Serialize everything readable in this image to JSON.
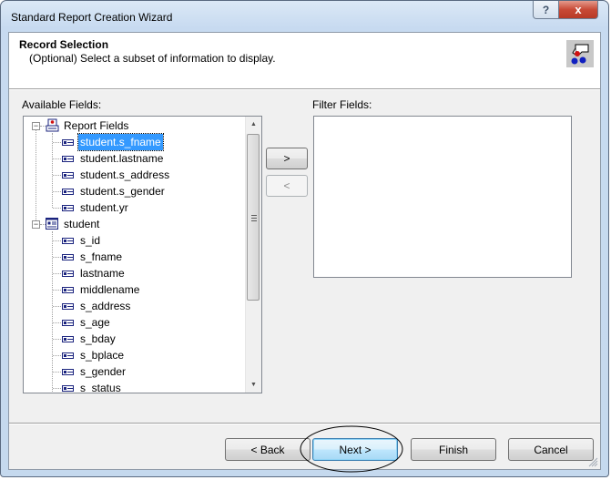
{
  "window": {
    "title": "Standard Report Creation Wizard",
    "help_label": "?",
    "close_label": "x"
  },
  "header": {
    "title": "Record Selection",
    "subtitle": "(Optional)  Select a subset of information to display.",
    "icon": "record-selection-wizard-icon"
  },
  "available": {
    "label": "Available Fields:",
    "groups": [
      {
        "label": "Report Fields",
        "icon": "report-fields-icon",
        "expanded": true,
        "items": [
          "student.s_fname",
          "student.lastname",
          "student.s_address",
          "student.s_gender",
          "student.yr"
        ]
      },
      {
        "label": "student",
        "icon": "table-icon",
        "expanded": true,
        "items": [
          "s_id",
          "s_fname",
          "lastname",
          "middlename",
          "s_address",
          "s_age",
          "s_bday",
          "s_bplace",
          "s_gender",
          "s_status"
        ]
      }
    ],
    "selected": "student.s_fname"
  },
  "move": {
    "add_label": ">",
    "remove_label": "<"
  },
  "filter": {
    "label": "Filter Fields:",
    "items": []
  },
  "footer": {
    "back_label": "< Back",
    "next_label": "Next >",
    "finish_label": "Finish",
    "cancel_label": "Cancel"
  },
  "annotation": {
    "type": "ellipse",
    "target": "next-button"
  }
}
